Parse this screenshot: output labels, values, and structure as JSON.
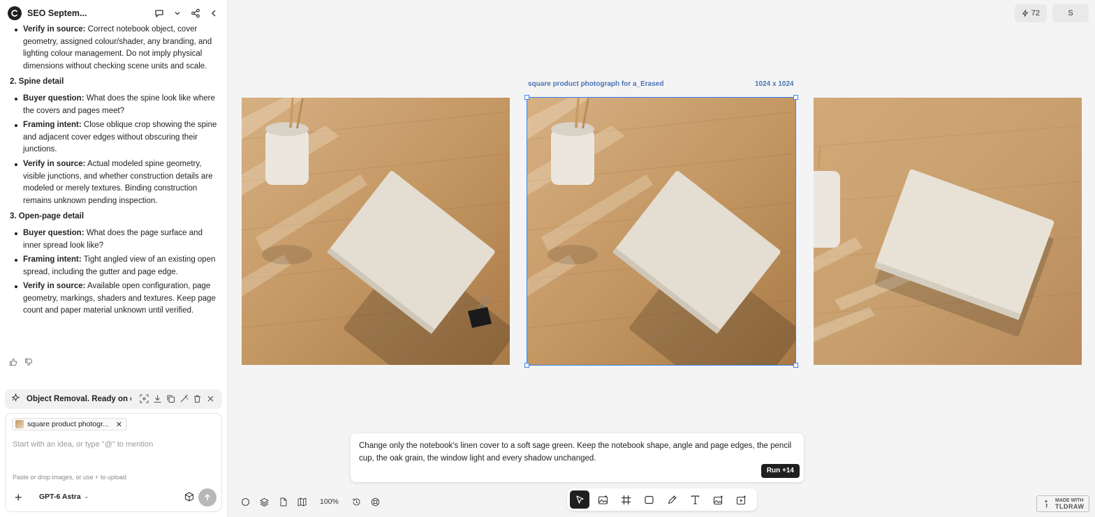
{
  "header": {
    "doc_title": "SEO Septem...",
    "credits": "72",
    "avatar": "S"
  },
  "content": {
    "verify_1": {
      "label": "Verify in source:",
      "text": " Correct notebook object, cover geometry, assigned colour/shader, any branding, and lighting colour management. Do not imply physical dimensions without checking scene units and scale."
    },
    "section_2": "2. Spine detail",
    "s2_items": [
      {
        "label": "Buyer question:",
        "text": " What does the spine look like where the covers and pages meet?"
      },
      {
        "label": "Framing intent:",
        "text": " Close oblique crop showing the spine and adjacent cover edges without obscuring their junctions."
      },
      {
        "label": "Verify in source:",
        "text": " Actual modeled spine geometry, visible junctions, and whether construction details are modeled or merely textures. Binding construction remains unknown pending inspection."
      }
    ],
    "section_3": "3. Open-page detail",
    "s3_items": [
      {
        "label": "Buyer question:",
        "text": " What does the page surface and inner spread look like?"
      },
      {
        "label": "Framing intent:",
        "text": " Tight angled view of an existing open spread, including the gutter and page edge."
      },
      {
        "label": "Verify in source:",
        "text": " Available open configuration, page geometry, markings, shaders and textures. Keep page count and paper material unknown until verified."
      }
    ]
  },
  "task": {
    "label": "Object Removal. Ready on c..."
  },
  "composer": {
    "chip_label": "square product photogr...",
    "placeholder": "Start with an idea, or type \"@\" to mention",
    "hint": "Paste or drop images, or use + to upload",
    "model": "GPT-6 Astra"
  },
  "canvas": {
    "selected_label": "square product photograph for a_Erased",
    "selected_size": "1024 x 1024",
    "zoom": "100%"
  },
  "prompt": {
    "text": "Change only the notebook's linen cover to a soft sage green. Keep the notebook shape, angle and page edges, the pencil cup, the oak grain, the window light and every shadow unchanged.",
    "run_label": "Run +14"
  },
  "watermark": {
    "line1": "MADE WITH",
    "line2": "TLDRAW"
  },
  "colors": {
    "accent": "#3b82f6",
    "wood": "#c9a06a",
    "linen": "#e2dcd0"
  }
}
